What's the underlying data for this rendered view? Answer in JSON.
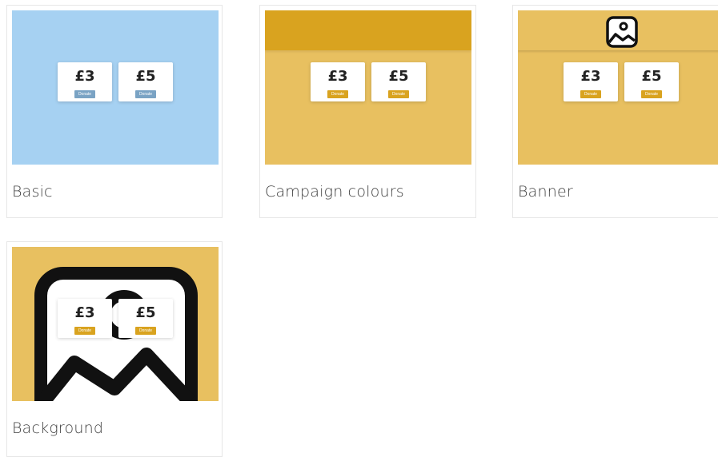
{
  "colors": {
    "basic_bg": "#a6d1f2",
    "basic_button": "#7aa3c4",
    "campaign_bg": "#e8c060",
    "campaign_band": "#d9a31f",
    "campaign_button": "#d9a31f",
    "border": "#e6e6e6"
  },
  "templates": [
    {
      "label": "Basic",
      "icon": null,
      "tickets": [
        {
          "amount": "£3",
          "button": "Donate"
        },
        {
          "amount": "£5",
          "button": "Donate"
        }
      ]
    },
    {
      "label": "Campaign colours",
      "icon": null,
      "tickets": [
        {
          "amount": "£3",
          "button": "Donate"
        },
        {
          "amount": "£5",
          "button": "Donate"
        }
      ]
    },
    {
      "label": "Banner",
      "icon": "image-icon",
      "tickets": [
        {
          "amount": "£3",
          "button": "Donate"
        },
        {
          "amount": "£5",
          "button": "Donate"
        }
      ]
    },
    {
      "label": "Background",
      "icon": "image-icon",
      "tickets": [
        {
          "amount": "£3",
          "button": "Donate"
        },
        {
          "amount": "£5",
          "button": "Donate"
        }
      ]
    }
  ]
}
